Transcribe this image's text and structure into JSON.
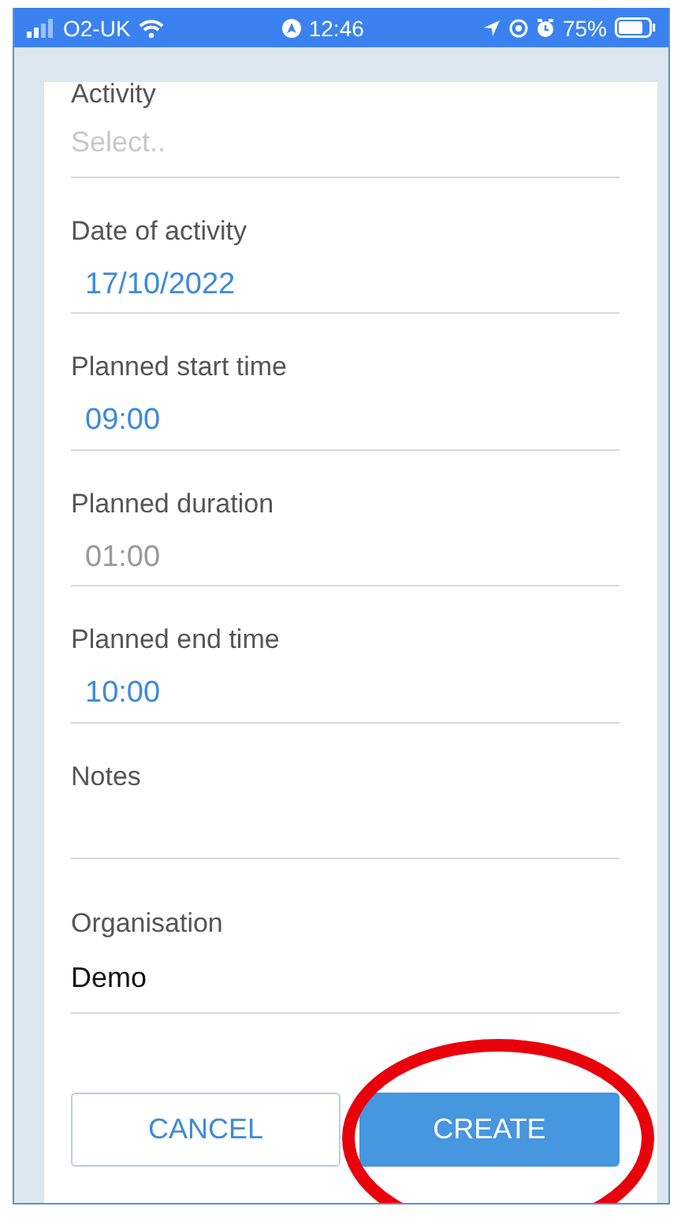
{
  "status_bar": {
    "carrier": "O2-UK",
    "time": "12:46",
    "battery": "75%"
  },
  "fields": [
    {
      "label": "Activity",
      "kind": "select",
      "placeholder": "Select.."
    },
    {
      "label": "Date of activity",
      "kind": "picker",
      "value": "17/10/2022"
    },
    {
      "label": "Planned start time",
      "kind": "picker",
      "value": "09:00"
    },
    {
      "label": "Planned duration",
      "kind": "readonly",
      "value": "01:00"
    },
    {
      "label": "Planned end time",
      "kind": "picker",
      "value": "10:00"
    },
    {
      "label": "Notes",
      "kind": "notes"
    },
    {
      "label": "Organisation",
      "kind": "text",
      "value": "Demo"
    }
  ],
  "buttons": [
    {
      "label": "CANCEL",
      "kind": "secondary"
    },
    {
      "label": "CREATE",
      "kind": "primary"
    }
  ],
  "annotation": {
    "kind": "ellipse",
    "color": "#e8000b"
  }
}
